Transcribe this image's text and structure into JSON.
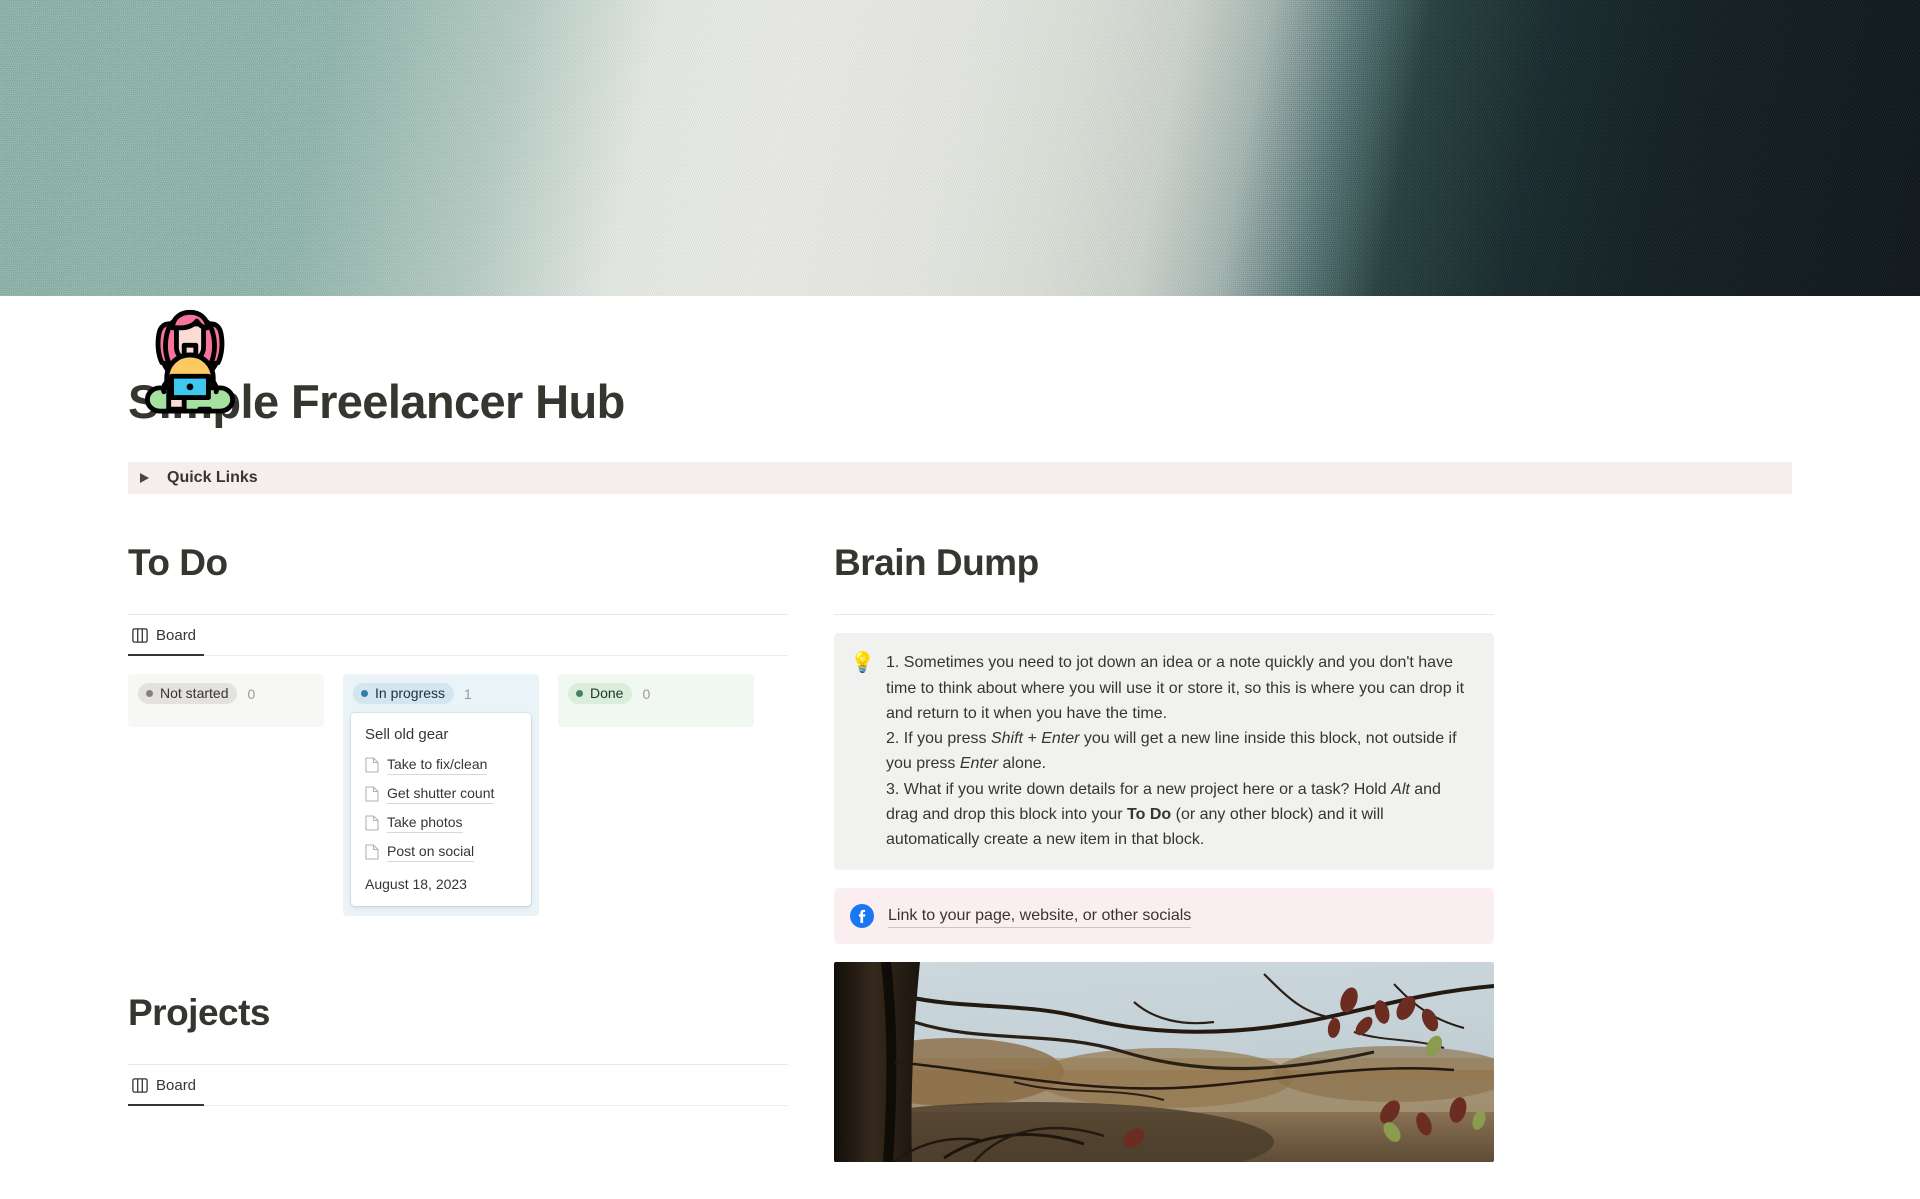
{
  "cover": {
    "name": "gradient-cover-image",
    "colors": [
      "#8fb5ab",
      "#edeee9",
      "#0c1418"
    ]
  },
  "page": {
    "icon_name": "woman-with-laptop-icon",
    "title": "Simple Freelancer Hub"
  },
  "quick_links": {
    "label": "Quick Links",
    "toggle_icon": "triangle-right-icon",
    "background": "#f6edee",
    "expanded": false
  },
  "todo": {
    "heading": "To Do",
    "view_tab": {
      "label": "Board",
      "icon": "board-view-icon",
      "active": true
    },
    "columns": [
      {
        "status": "Not started",
        "count": "0",
        "pill_bg": "#e3e2e0",
        "dot_color": "#84817c",
        "cards": []
      },
      {
        "status": "In progress",
        "count": "1",
        "pill_bg": "#d3e5ef",
        "dot_color": "#337ea9",
        "cards": [
          {
            "title": "Sell old gear",
            "subitems": [
              "Take to fix/clean",
              "Get shutter count",
              "Take photos",
              "Post on social"
            ],
            "date": "August 18, 2023"
          }
        ]
      },
      {
        "status": "Done",
        "count": "0",
        "pill_bg": "#dbeddb",
        "dot_color": "#448361",
        "cards": []
      }
    ]
  },
  "projects": {
    "heading": "Projects",
    "view_tab": {
      "label": "Board",
      "icon": "board-view-icon",
      "active": true
    }
  },
  "brain_dump": {
    "heading": "Brain Dump",
    "callout": {
      "emoji": "💡",
      "icon_name": "light-bulb-icon",
      "background": "#f1f1ef",
      "paragraph_1": "1. Sometimes you need to jot down an idea or a note quickly and you don't have time to think about where you will use it or store it, so this is where you can drop it and return to it when you have the time.",
      "paragraph_2_a": "2. If you press ",
      "paragraph_2_kbd1": "Shift + Enter",
      "paragraph_2_b": " you will get a new line inside this block, not outside if you press ",
      "paragraph_2_kbd2": "Enter",
      "paragraph_2_c": " alone.",
      "paragraph_3_a": "3. What if you write down details for a new project here or a task? Hold ",
      "paragraph_3_alt": "Alt",
      "paragraph_3_b": " and drag and drop this block into your ",
      "paragraph_3_bold": "To Do",
      "paragraph_3_c": " (or any other block) and it will automatically create a new item in that block."
    },
    "social_callout": {
      "icon_name": "facebook-icon",
      "background": "#fbeef0",
      "link_text": "Link to your page, website, or other socials"
    },
    "photo": {
      "name": "autumn-branches-photo",
      "alt": "Bare autumn branches with dry leaves against a pale sky"
    }
  }
}
